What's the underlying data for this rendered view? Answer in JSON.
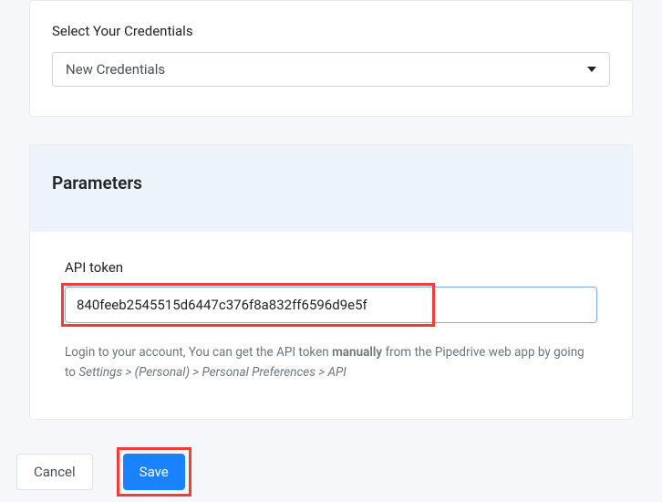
{
  "credentials": {
    "label": "Select Your Credentials",
    "selected": "New Credentials"
  },
  "parameters": {
    "title": "Parameters",
    "api_token_label": "API token",
    "api_token_value": "840feeb2545515d6447c376f8a832ff6596d9e5f",
    "help_prefix": "Login to your account, You can get the API token ",
    "help_bold": "manually",
    "help_mid": " from the Pipedrive web app by going to ",
    "help_path": "Settings > (Personal) > Personal Preferences > API"
  },
  "footer": {
    "cancel": "Cancel",
    "save": "Save"
  }
}
